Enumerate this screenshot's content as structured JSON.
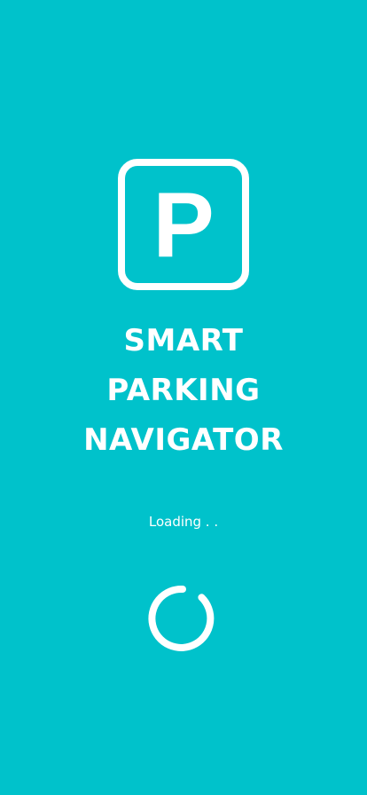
{
  "app": {
    "logo_letter": "P",
    "title_lines": [
      "SMART",
      "PARKING",
      "NAVIGATOR"
    ],
    "loading_text": "Loading . ."
  },
  "colors": {
    "background": "#00c2cb",
    "foreground": "#ffffff"
  },
  "icons": {
    "logo": "parking-sign-icon",
    "spinner": "loading-spinner-icon"
  }
}
